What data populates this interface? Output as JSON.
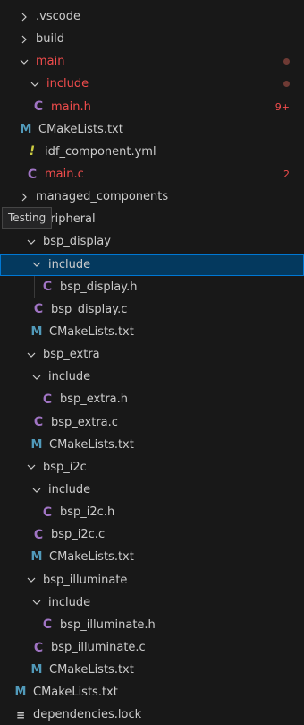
{
  "explorer": {
    "rows": [
      {
        "label": ".vscode",
        "icon": "chevron-right-icon",
        "kind": "folder",
        "depth": 0
      },
      {
        "label": "build",
        "icon": "chevron-right-icon",
        "kind": "folder",
        "depth": 0
      },
      {
        "label": "main",
        "icon": "chevron-down-icon",
        "kind": "folder",
        "depth": 0,
        "status": "error-dot"
      },
      {
        "label": "include",
        "icon": "chevron-down-icon",
        "kind": "folder",
        "depth": 1,
        "status": "error-dot"
      },
      {
        "label": "main.h",
        "icon": "c-file-icon",
        "kind": "file",
        "depth": 1,
        "badge": "9+"
      },
      {
        "label": "CMakeLists.txt",
        "icon": "cmake-file-icon",
        "kind": "file",
        "depth": 0
      },
      {
        "label": "idf_component.yml",
        "icon": "yaml-file-icon",
        "kind": "file",
        "depth": 0
      },
      {
        "label": "main.c",
        "icon": "c-file-icon",
        "kind": "file",
        "depth": 0,
        "badge": "2"
      },
      {
        "label": "managed_components",
        "icon": "chevron-right-icon",
        "kind": "folder",
        "depth": 0
      },
      {
        "label": "peripheral",
        "icon": "chevron-down-icon",
        "kind": "folder",
        "depth": 0
      },
      {
        "label": "bsp_display",
        "icon": "chevron-down-icon",
        "kind": "folder",
        "depth": 1
      },
      {
        "label": "include",
        "icon": "chevron-down-icon",
        "kind": "folder",
        "depth": 2,
        "selected": true
      },
      {
        "label": "bsp_display.h",
        "icon": "c-file-icon",
        "kind": "file",
        "depth": 3
      },
      {
        "label": "bsp_display.c",
        "icon": "c-file-icon",
        "kind": "file",
        "depth": 2
      },
      {
        "label": "CMakeLists.txt",
        "icon": "cmake-file-icon",
        "kind": "file",
        "depth": 2
      },
      {
        "label": "bsp_extra",
        "icon": "chevron-down-icon",
        "kind": "folder",
        "depth": 1
      },
      {
        "label": "include",
        "icon": "chevron-down-icon",
        "kind": "folder",
        "depth": 2
      },
      {
        "label": "bsp_extra.h",
        "icon": "c-file-icon",
        "kind": "file",
        "depth": 3
      },
      {
        "label": "bsp_extra.c",
        "icon": "c-file-icon",
        "kind": "file",
        "depth": 2
      },
      {
        "label": "CMakeLists.txt",
        "icon": "cmake-file-icon",
        "kind": "file",
        "depth": 2
      },
      {
        "label": "bsp_i2c",
        "icon": "chevron-down-icon",
        "kind": "folder",
        "depth": 1
      },
      {
        "label": "include",
        "icon": "chevron-down-icon",
        "kind": "folder",
        "depth": 2
      },
      {
        "label": "bsp_i2c.h",
        "icon": "c-file-icon",
        "kind": "file",
        "depth": 3
      },
      {
        "label": "bsp_i2c.c",
        "icon": "c-file-icon",
        "kind": "file",
        "depth": 2
      },
      {
        "label": "CMakeLists.txt",
        "icon": "cmake-file-icon",
        "kind": "file",
        "depth": 2
      },
      {
        "label": "bsp_illuminate",
        "icon": "chevron-down-icon",
        "kind": "folder",
        "depth": 1
      },
      {
        "label": "include",
        "icon": "chevron-down-icon",
        "kind": "folder",
        "depth": 2
      },
      {
        "label": "bsp_illuminate.h",
        "icon": "c-file-icon",
        "kind": "file",
        "depth": 3
      },
      {
        "label": "bsp_illuminate.c",
        "icon": "c-file-icon",
        "kind": "file",
        "depth": 2
      },
      {
        "label": "CMakeLists.txt",
        "icon": "cmake-file-icon",
        "kind": "file",
        "depth": 2
      },
      {
        "label": "CMakeLists.txt",
        "icon": "cmake-file-icon",
        "kind": "file",
        "depth": -1
      },
      {
        "label": "dependencies.lock",
        "icon": "lines-file-icon",
        "kind": "file",
        "depth": -1
      }
    ]
  },
  "tooltip": {
    "text": "Testing"
  },
  "colors": {
    "background": "#181818",
    "text": "#cccccc",
    "error": "#f14c4c",
    "c_icon": "#a074c4",
    "cmake_icon": "#519aba",
    "yaml_icon": "#cbcb41",
    "selection": "#04395e",
    "selection_border": "#0078d4",
    "error_dot": "#6e3a34"
  }
}
